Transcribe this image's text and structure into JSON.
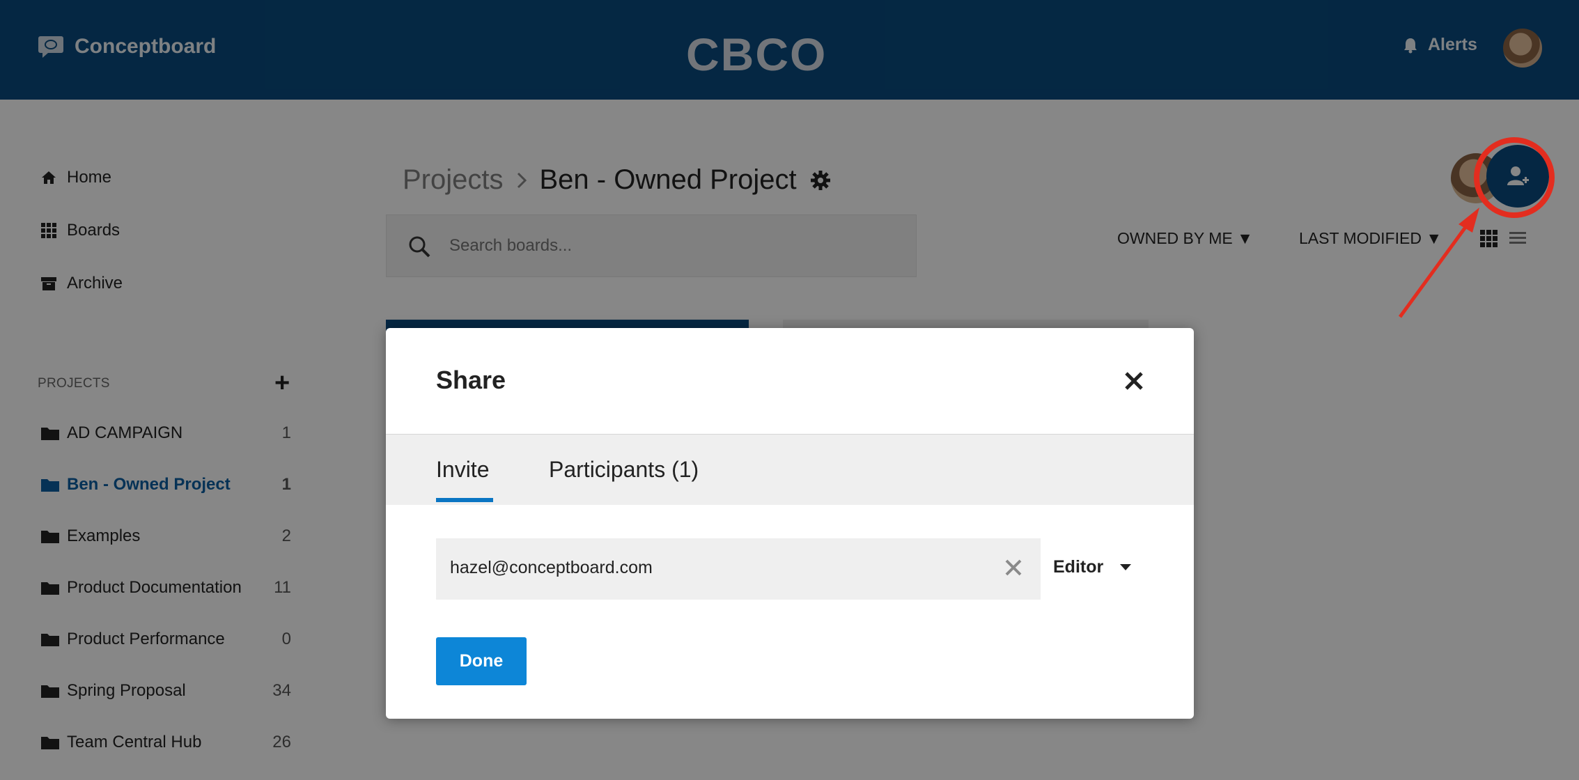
{
  "header": {
    "brand": "Conceptboard",
    "center_logo": "CBCO",
    "alerts_label": "Alerts"
  },
  "sidebar": {
    "home_label": "Home",
    "boards_label": "Boards",
    "archive_label": "Archive",
    "projects_heading": "PROJECTS",
    "projects": [
      {
        "name": "AD CAMPAIGN",
        "count": "1"
      },
      {
        "name": "Ben - Owned Project",
        "count": "1"
      },
      {
        "name": "Examples",
        "count": "2"
      },
      {
        "name": "Product Documentation",
        "count": "11"
      },
      {
        "name": "Product Performance",
        "count": "0"
      },
      {
        "name": "Spring Proposal",
        "count": "34"
      },
      {
        "name": "Team Central Hub",
        "count": "26"
      }
    ]
  },
  "main": {
    "crumb_parent": "Projects",
    "crumb_current": "Ben - Owned Project",
    "search_placeholder": "Search boards...",
    "filter_owner": "OWNED BY ME ▼",
    "filter_sort": "LAST MODIFIED ▼"
  },
  "modal": {
    "title": "Share",
    "tabs": [
      "Invite",
      "Participants (1)"
    ],
    "email_value": "hazel@conceptboard.com",
    "role_label": "Editor",
    "done_label": "Done"
  },
  "icons": [
    "chat-bubble-icon",
    "bell-icon",
    "home-icon",
    "grid-icon",
    "archive-icon",
    "folder-icon",
    "gear-icon",
    "search-icon",
    "list-icon",
    "add-user-icon",
    "close-icon",
    "clear-icon",
    "caret-down-icon"
  ],
  "colors": {
    "header_bg": "#0a4b7f",
    "accent": "#0d86d7",
    "annotation": "#e32d1f"
  }
}
